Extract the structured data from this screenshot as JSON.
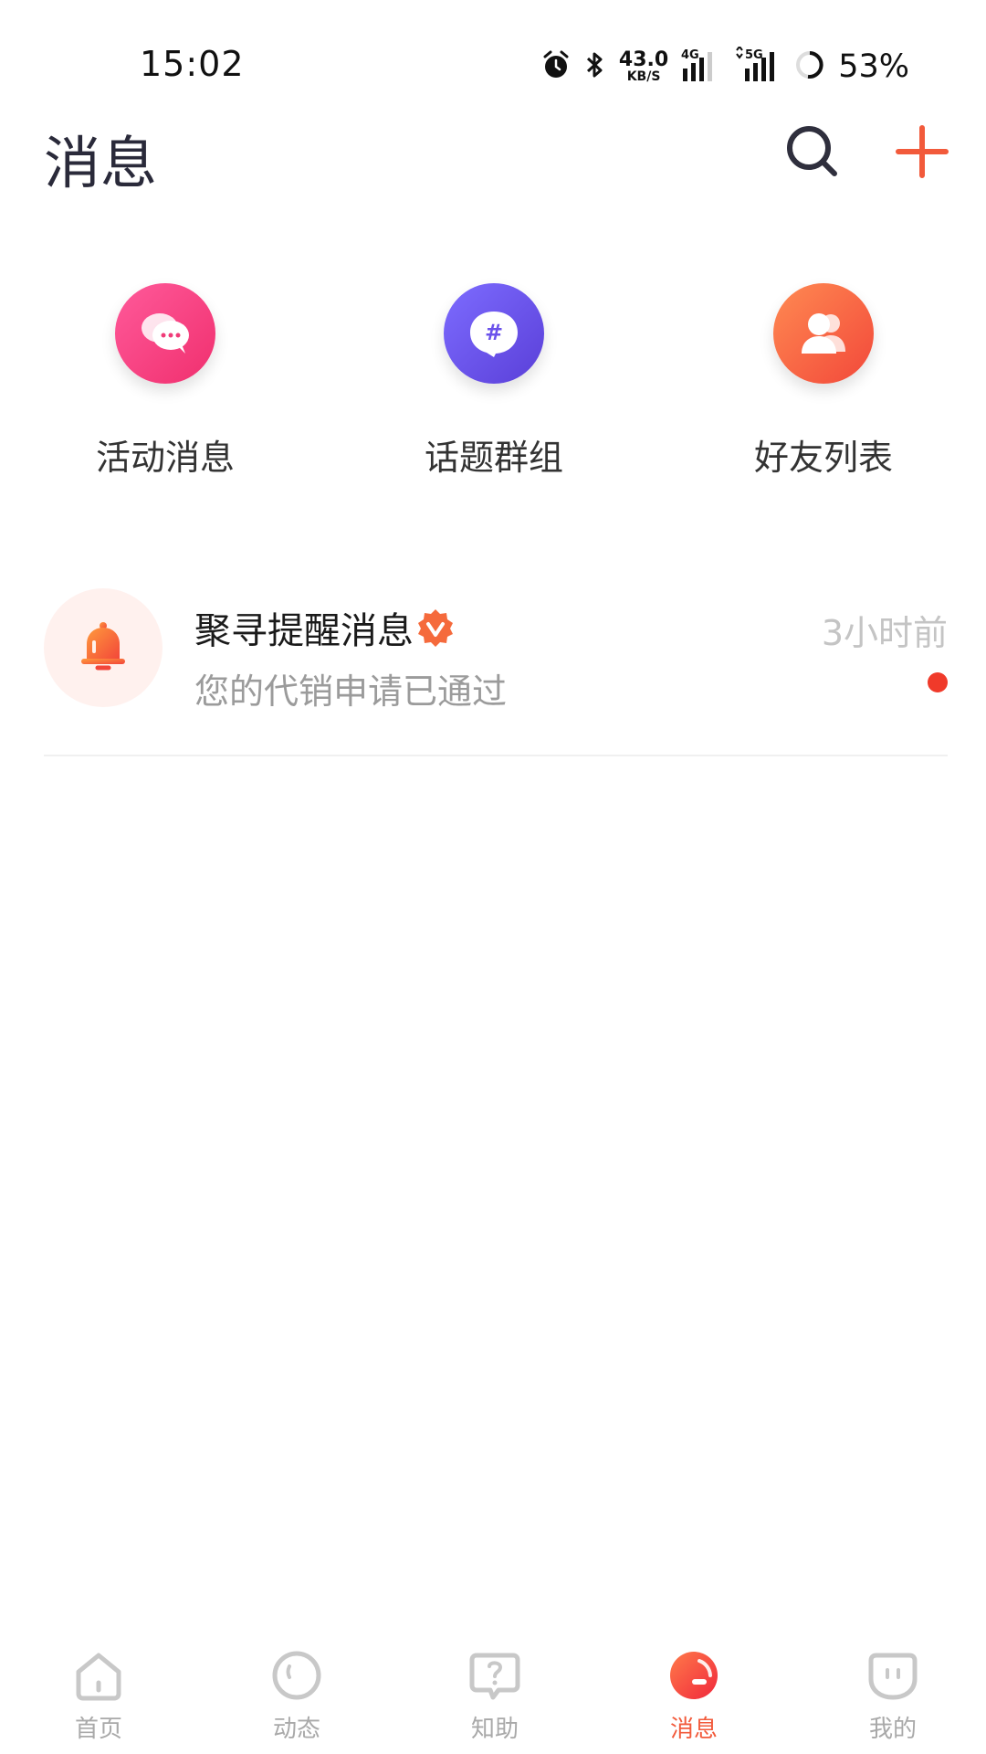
{
  "status_bar": {
    "time": "15:02",
    "net_speed_value": "43.0",
    "net_speed_unit": "KB/S",
    "network_1": "4G",
    "network_2": "5G",
    "battery": "53%",
    "icons": [
      "alarm-icon",
      "bluetooth-icon",
      "signal-4g-icon",
      "signal-5g-icon",
      "battery-ring-icon"
    ]
  },
  "header": {
    "title": "消息",
    "search_icon": "search-icon",
    "add_icon": "plus-icon",
    "accent_color": "#f25a3b"
  },
  "quick_entries": [
    {
      "label": "活动消息",
      "icon": "chat-bubbles-icon",
      "color": "#f03b78"
    },
    {
      "label": "话题群组",
      "icon": "hashtag-bubble-icon",
      "color": "#6b52eb"
    },
    {
      "label": "好友列表",
      "icon": "friends-icon",
      "color": "#f5663f"
    }
  ],
  "messages": [
    {
      "title": "聚寻提醒消息",
      "verified": true,
      "preview": "您的代销申请已通过",
      "time": "3小时前",
      "unread": true,
      "icon": "bell-icon"
    }
  ],
  "bottom_nav": {
    "items": [
      {
        "label": "首页",
        "icon": "home-icon",
        "active": false
      },
      {
        "label": "动态",
        "icon": "circle-face-icon",
        "active": false
      },
      {
        "label": "知助",
        "icon": "question-bubble-icon",
        "active": false
      },
      {
        "label": "消息",
        "icon": "message-icon",
        "active": true
      },
      {
        "label": "我的",
        "icon": "profile-face-icon",
        "active": false
      }
    ]
  }
}
